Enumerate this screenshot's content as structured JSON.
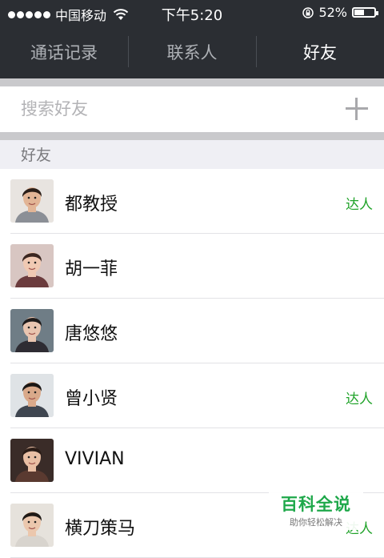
{
  "status_bar": {
    "carrier": "中国移动",
    "time": "下午5:20",
    "battery_text": "52%",
    "battery_level": 0.52,
    "signal_bars": 5
  },
  "tabs": [
    {
      "label": "通话记录",
      "active": false
    },
    {
      "label": "联系人",
      "active": false
    },
    {
      "label": "好友",
      "active": true
    }
  ],
  "search": {
    "placeholder": "搜索好友",
    "add_icon": "plus-icon"
  },
  "section": {
    "title": "好友"
  },
  "friends": [
    {
      "name": "都教授",
      "badge": "达人",
      "avatar_colors": {
        "bg": "#e8e4e0",
        "skin": "#e2b596",
        "hair": "#2a1e18",
        "cloth": "#8b8f96"
      }
    },
    {
      "name": "胡一菲",
      "badge": "",
      "avatar_colors": {
        "bg": "#d8c6c2",
        "skin": "#f0c9b3",
        "hair": "#3a2620",
        "cloth": "#6b3b3d"
      }
    },
    {
      "name": "唐悠悠",
      "badge": "",
      "avatar_colors": {
        "bg": "#6f7d86",
        "skin": "#e9c5b0",
        "hair": "#1e1a1a",
        "cloth": "#2e2c33"
      }
    },
    {
      "name": "曾小贤",
      "badge": "达人",
      "avatar_colors": {
        "bg": "#dfe3e6",
        "skin": "#d9a98a",
        "hair": "#1a1614",
        "cloth": "#3f4650"
      }
    },
    {
      "name": "VIVIAN",
      "badge": "",
      "avatar_colors": {
        "bg": "#3a2c28",
        "skin": "#e9bfa4",
        "hair": "#2a1c16",
        "cloth": "#5a3a30"
      }
    },
    {
      "name": "横刀策马",
      "badge": "达人",
      "avatar_colors": {
        "bg": "#e6e2dc",
        "skin": "#ebc7ad",
        "hair": "#1f1915",
        "cloth": "#d8d4ce"
      }
    }
  ],
  "watermark": {
    "title": "百科全说",
    "subtitle": "助你轻松解决"
  },
  "colors": {
    "bar_bg": "#2b2e33",
    "accent_green": "#21a32a",
    "section_bg": "#efeff4"
  }
}
